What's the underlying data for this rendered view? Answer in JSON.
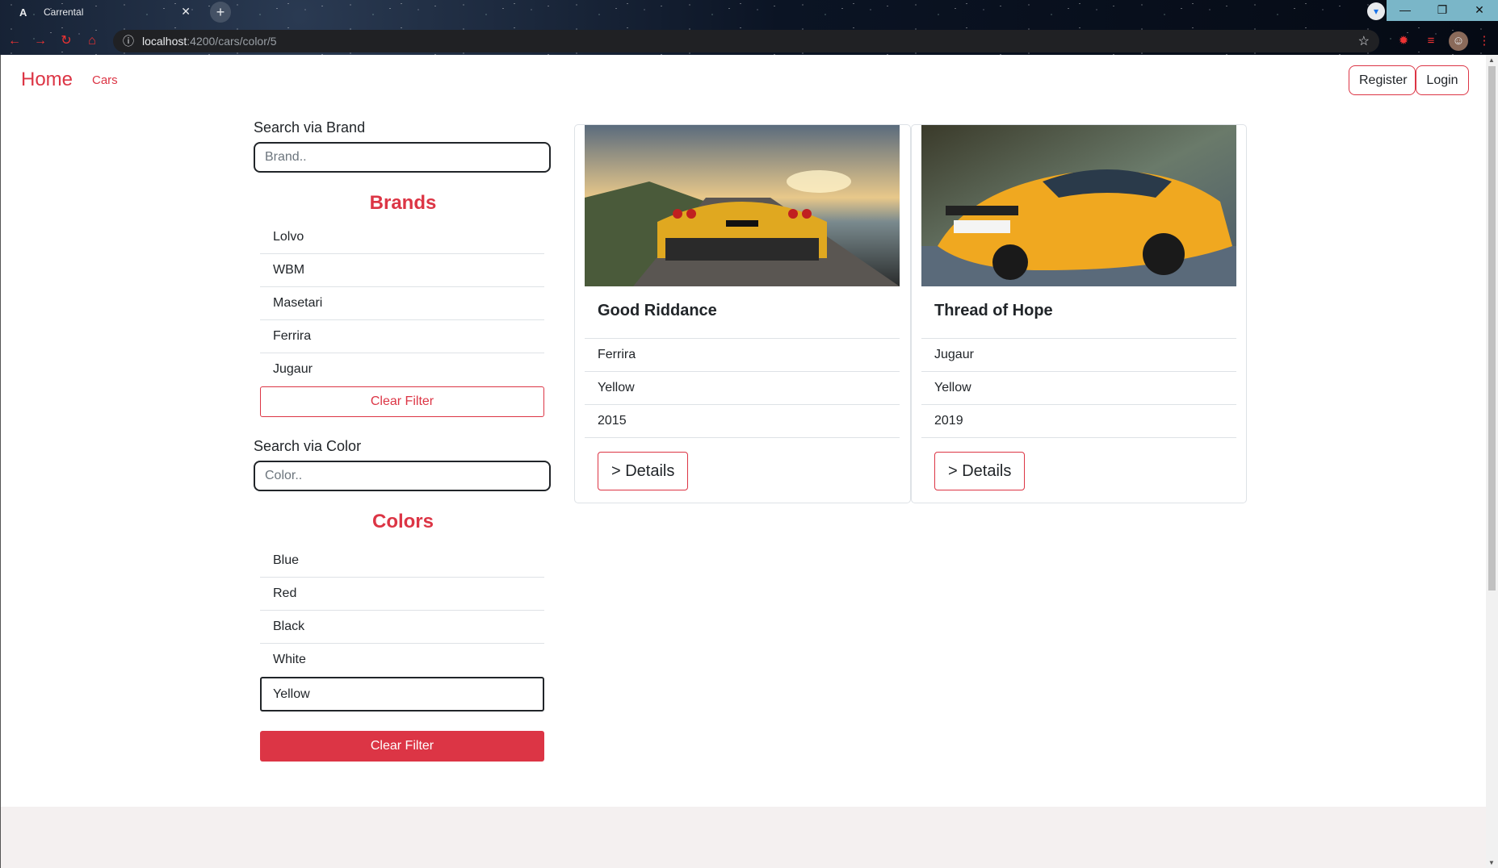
{
  "browser": {
    "tab_title": "Carrental",
    "tab_favicon": "A",
    "url_host": "localhost",
    "url_path": ":4200/cars/color/5"
  },
  "navbar": {
    "brand": "Home",
    "link_cars": "Cars",
    "register": "Register",
    "login": "Login"
  },
  "brand_filter": {
    "label": "Search via Brand",
    "placeholder": "Brand..",
    "title": "Brands",
    "items": [
      "Lolvo",
      "WBM",
      "Masetari",
      "Ferrira",
      "Jugaur"
    ],
    "clear": "Clear Filter"
  },
  "color_filter": {
    "label": "Search via Color",
    "placeholder": "Color..",
    "title": "Colors",
    "items": [
      "Blue",
      "Red",
      "Black",
      "White",
      "Yellow"
    ],
    "selected": "Yellow",
    "clear": "Clear Filter"
  },
  "cars": [
    {
      "name": "Good Riddance",
      "brand": "Ferrira",
      "color": "Yellow",
      "year": "2015",
      "details": "> Details"
    },
    {
      "name": "Thread of Hope",
      "brand": "Jugaur",
      "color": "Yellow",
      "year": "2019",
      "details": "> Details"
    }
  ],
  "colors": {
    "accent": "#dc3545",
    "text": "#212529",
    "footer_bg": "#f4f0f0"
  }
}
